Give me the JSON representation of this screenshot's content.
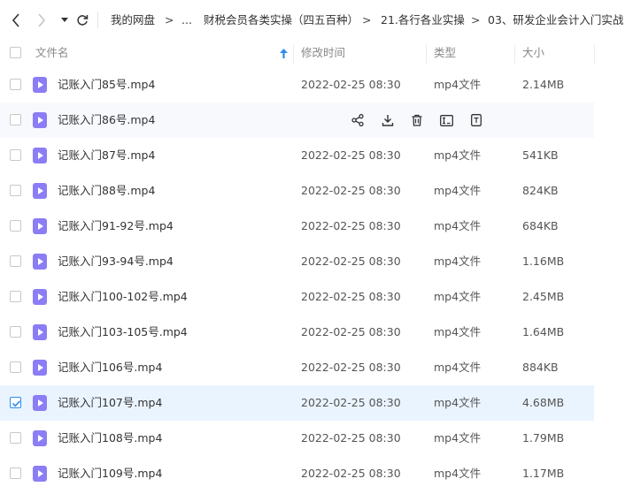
{
  "breadcrumb": {
    "root": "我的网盘",
    "ellipsis": "...",
    "items": [
      "财税会员各类实操（四五百种）",
      "21.各行各业实操",
      "03、研发企业会计入门实战"
    ],
    "separator": ">"
  },
  "columns": {
    "name": "文件名",
    "modified": "修改时间",
    "type": "类型",
    "size": "大小"
  },
  "files": [
    {
      "name": "记账入门85号.mp4",
      "modified": "2022-02-25 08:30",
      "type": "mp4文件",
      "size": "2.14MB"
    },
    {
      "name": "记账入门86号.mp4",
      "modified": "",
      "type": "",
      "size": ""
    },
    {
      "name": "记账入门87号.mp4",
      "modified": "2022-02-25 08:30",
      "type": "mp4文件",
      "size": "541KB"
    },
    {
      "name": "记账入门88号.mp4",
      "modified": "2022-02-25 08:30",
      "type": "mp4文件",
      "size": "824KB"
    },
    {
      "name": "记账入门91-92号.mp4",
      "modified": "2022-02-25 08:30",
      "type": "mp4文件",
      "size": "684KB"
    },
    {
      "name": "记账入门93-94号.mp4",
      "modified": "2022-02-25 08:30",
      "type": "mp4文件",
      "size": "1.16MB"
    },
    {
      "name": "记账入门100-102号.mp4",
      "modified": "2022-02-25 08:30",
      "type": "mp4文件",
      "size": "2.45MB"
    },
    {
      "name": "记账入门103-105号.mp4",
      "modified": "2022-02-25 08:30",
      "type": "mp4文件",
      "size": "1.64MB"
    },
    {
      "name": "记账入门106号.mp4",
      "modified": "2022-02-25 08:30",
      "type": "mp4文件",
      "size": "884KB"
    },
    {
      "name": "记账入门107号.mp4",
      "modified": "2022-02-25 08:30",
      "type": "mp4文件",
      "size": "4.68MB"
    },
    {
      "name": "记账入门108号.mp4",
      "modified": "2022-02-25 08:30",
      "type": "mp4文件",
      "size": "1.79MB"
    },
    {
      "name": "记账入门109号.mp4",
      "modified": "2022-02-25 08:30",
      "type": "mp4文件",
      "size": "1.17MB"
    }
  ],
  "row_actions": [
    "share-icon",
    "download-icon",
    "delete-icon",
    "rename-icon",
    "more-icon"
  ],
  "colors": {
    "accent": "#2d8cf0",
    "file_icon": "#8b7df5",
    "selected_row": "#eaf4ff",
    "hover_row": "#f7f9fd"
  }
}
